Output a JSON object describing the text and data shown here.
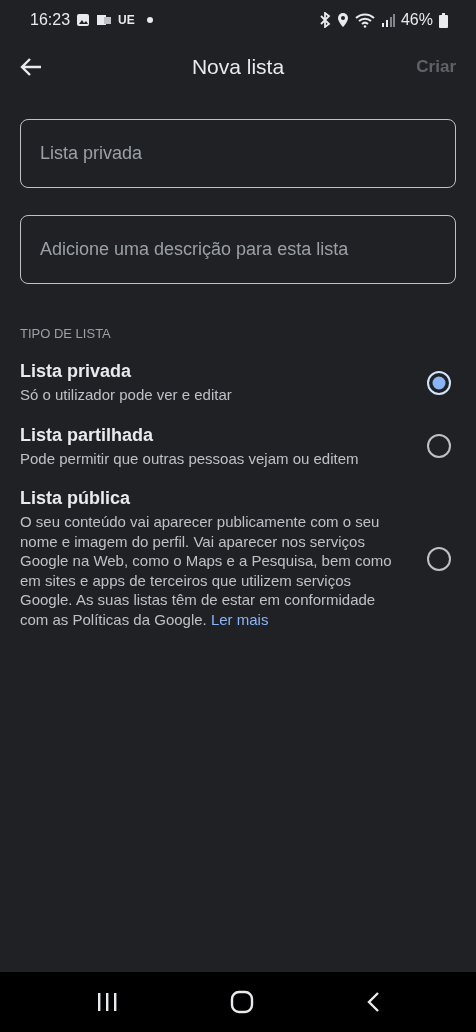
{
  "status_bar": {
    "time": "16:23",
    "carrier": "UE",
    "battery": "46%"
  },
  "app_bar": {
    "title": "Nova lista",
    "action": {
      "label": "Criar",
      "disabled": true
    }
  },
  "fields": [
    {
      "placeholder": "Lista privada"
    },
    {
      "placeholder": "Adicione uma descrição para esta lista"
    }
  ],
  "section": {
    "title": "TIPO DE LISTA"
  },
  "options": [
    {
      "title": "Lista privada",
      "description": "Só o utilizador pode ver e editar",
      "selected": true
    },
    {
      "title": "Lista partilhada",
      "description": "Pode permitir que outras pessoas vejam ou editem",
      "selected": false
    },
    {
      "title": "Lista pública",
      "description": "O seu conteúdo vai aparecer publicamente com o seu nome e imagem do perfil. Vai aparecer nos serviços Google na Web, como o Maps e a Pesquisa, bem como em sites e apps de terceiros que utilizem serviços Google. As suas listas têm de estar em conformidade com as Políticas da Google.",
      "link": "Ler mais",
      "selected": false
    }
  ]
}
